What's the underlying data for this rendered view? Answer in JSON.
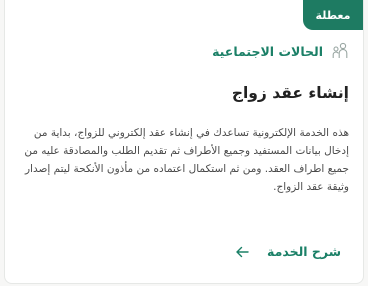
{
  "card": {
    "badge": "معطلة",
    "category": "الحالات الاجتماعية",
    "title": "إنشاء عقد زواج",
    "description": "هذه الخدمة الإلكترونية تساعدك في إنشاء عقد إلكتروني للزواج، بداية من إدخال بيانات المستفيد وجميع الأطراف ثم تقديم الطلب والمصادقة عليه من جميع اطراف العقد. ومن ثم استكمال اعتماده من مأذون الأنكحة ليتم إصدار وثيقة عقد الزواج.",
    "link_label": "شرح الخدمة"
  },
  "icons": {
    "category": "people-icon",
    "link": "arrow-left-icon"
  },
  "colors": {
    "brand": "#1e7b62",
    "accent_text": "#1b8067",
    "title": "#222222",
    "body_text": "#4a4a4a"
  }
}
